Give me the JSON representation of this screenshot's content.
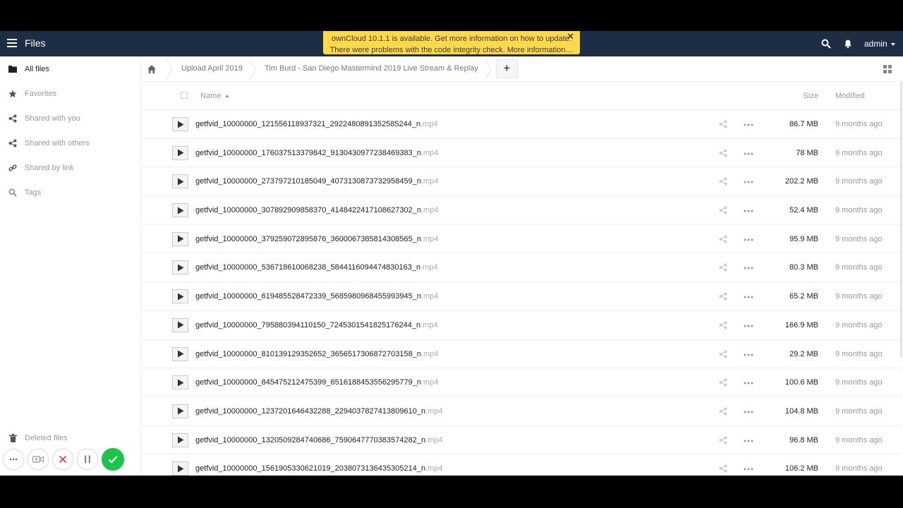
{
  "header": {
    "app_title": "Files",
    "user": "admin"
  },
  "notification": {
    "line1": "ownCloud 10.1.1 is available. Get more information on how to update.",
    "line2": "There were problems with the code integrity check. More information…",
    "close": "✕"
  },
  "sidebar": {
    "items": [
      {
        "label": "All files",
        "icon": "folder-icon",
        "active": true
      },
      {
        "label": "Favorites",
        "icon": "star-icon"
      },
      {
        "label": "Shared with you",
        "icon": "share-icon"
      },
      {
        "label": "Shared with others",
        "icon": "share-icon"
      },
      {
        "label": "Shared by link",
        "icon": "link-icon"
      },
      {
        "label": "Tags",
        "icon": "tag-search-icon"
      }
    ],
    "deleted_files": "Deleted files"
  },
  "breadcrumb": {
    "items": [
      "Upload April 2019",
      "Tim Burd - San Diego Mastermind 2019 Live Stream & Replay"
    ],
    "new_button": "+"
  },
  "table": {
    "columns": {
      "name": "Name",
      "size": "Size",
      "modified": "Modified"
    },
    "rows": [
      {
        "name": "getfvid_10000000_121556118937321_2922480891352585244_n",
        "ext": ".mp4",
        "size": "86.7 MB",
        "modified": "9 months ago"
      },
      {
        "name": "getfvid_10000000_176037513379842_9130430977238469383_n",
        "ext": ".mp4",
        "size": "78 MB",
        "modified": "9 months ago"
      },
      {
        "name": "getfvid_10000000_273797210185049_4073130873732958459_n",
        "ext": ".mp4",
        "size": "202.2 MB",
        "modified": "9 months ago"
      },
      {
        "name": "getfvid_10000000_307892909858370_4148422417108627302_n",
        "ext": ".mp4",
        "size": "52.4 MB",
        "modified": "9 months ago"
      },
      {
        "name": "getfvid_10000000_379259072895876_3600067385814308565_n",
        "ext": ".mp4",
        "size": "95.9 MB",
        "modified": "9 months ago"
      },
      {
        "name": "getfvid_10000000_536718610068238_5844116094474830163_n",
        "ext": ".mp4",
        "size": "80.3 MB",
        "modified": "9 months ago"
      },
      {
        "name": "getfvid_10000000_619485528472339_5685980968455993945_n",
        "ext": ".mp4",
        "size": "65.2 MB",
        "modified": "9 months ago"
      },
      {
        "name": "getfvid_10000000_795880394110150_7245301541825176244_n",
        "ext": ".mp4",
        "size": "166.9 MB",
        "modified": "9 months ago"
      },
      {
        "name": "getfvid_10000000_810139129352652_3656517306872703158_n",
        "ext": ".mp4",
        "size": "29.2 MB",
        "modified": "9 months ago"
      },
      {
        "name": "getfvid_10000000_845475212475399_6516188453556295779_n",
        "ext": ".mp4",
        "size": "100.6 MB",
        "modified": "9 months ago"
      },
      {
        "name": "getfvid_10000000_1237201646432288_2294037827413809610_n",
        "ext": ".mp4",
        "size": "104.8 MB",
        "modified": "9 months ago"
      },
      {
        "name": "getfvid_10000000_1320509284740686_7590647770383574282_n",
        "ext": ".mp4",
        "size": "96.8 MB",
        "modified": "9 months ago"
      },
      {
        "name": "getfvid_10000000_1561905330621019_2038073136435305214_n",
        "ext": ".mp4",
        "size": "106.2 MB",
        "modified": "9 months ago"
      }
    ]
  },
  "colors": {
    "header_bg": "#1d2d44",
    "notification_bg": "#fed94b",
    "accept_green": "#1dc449",
    "reject_red": "#e0403a"
  }
}
